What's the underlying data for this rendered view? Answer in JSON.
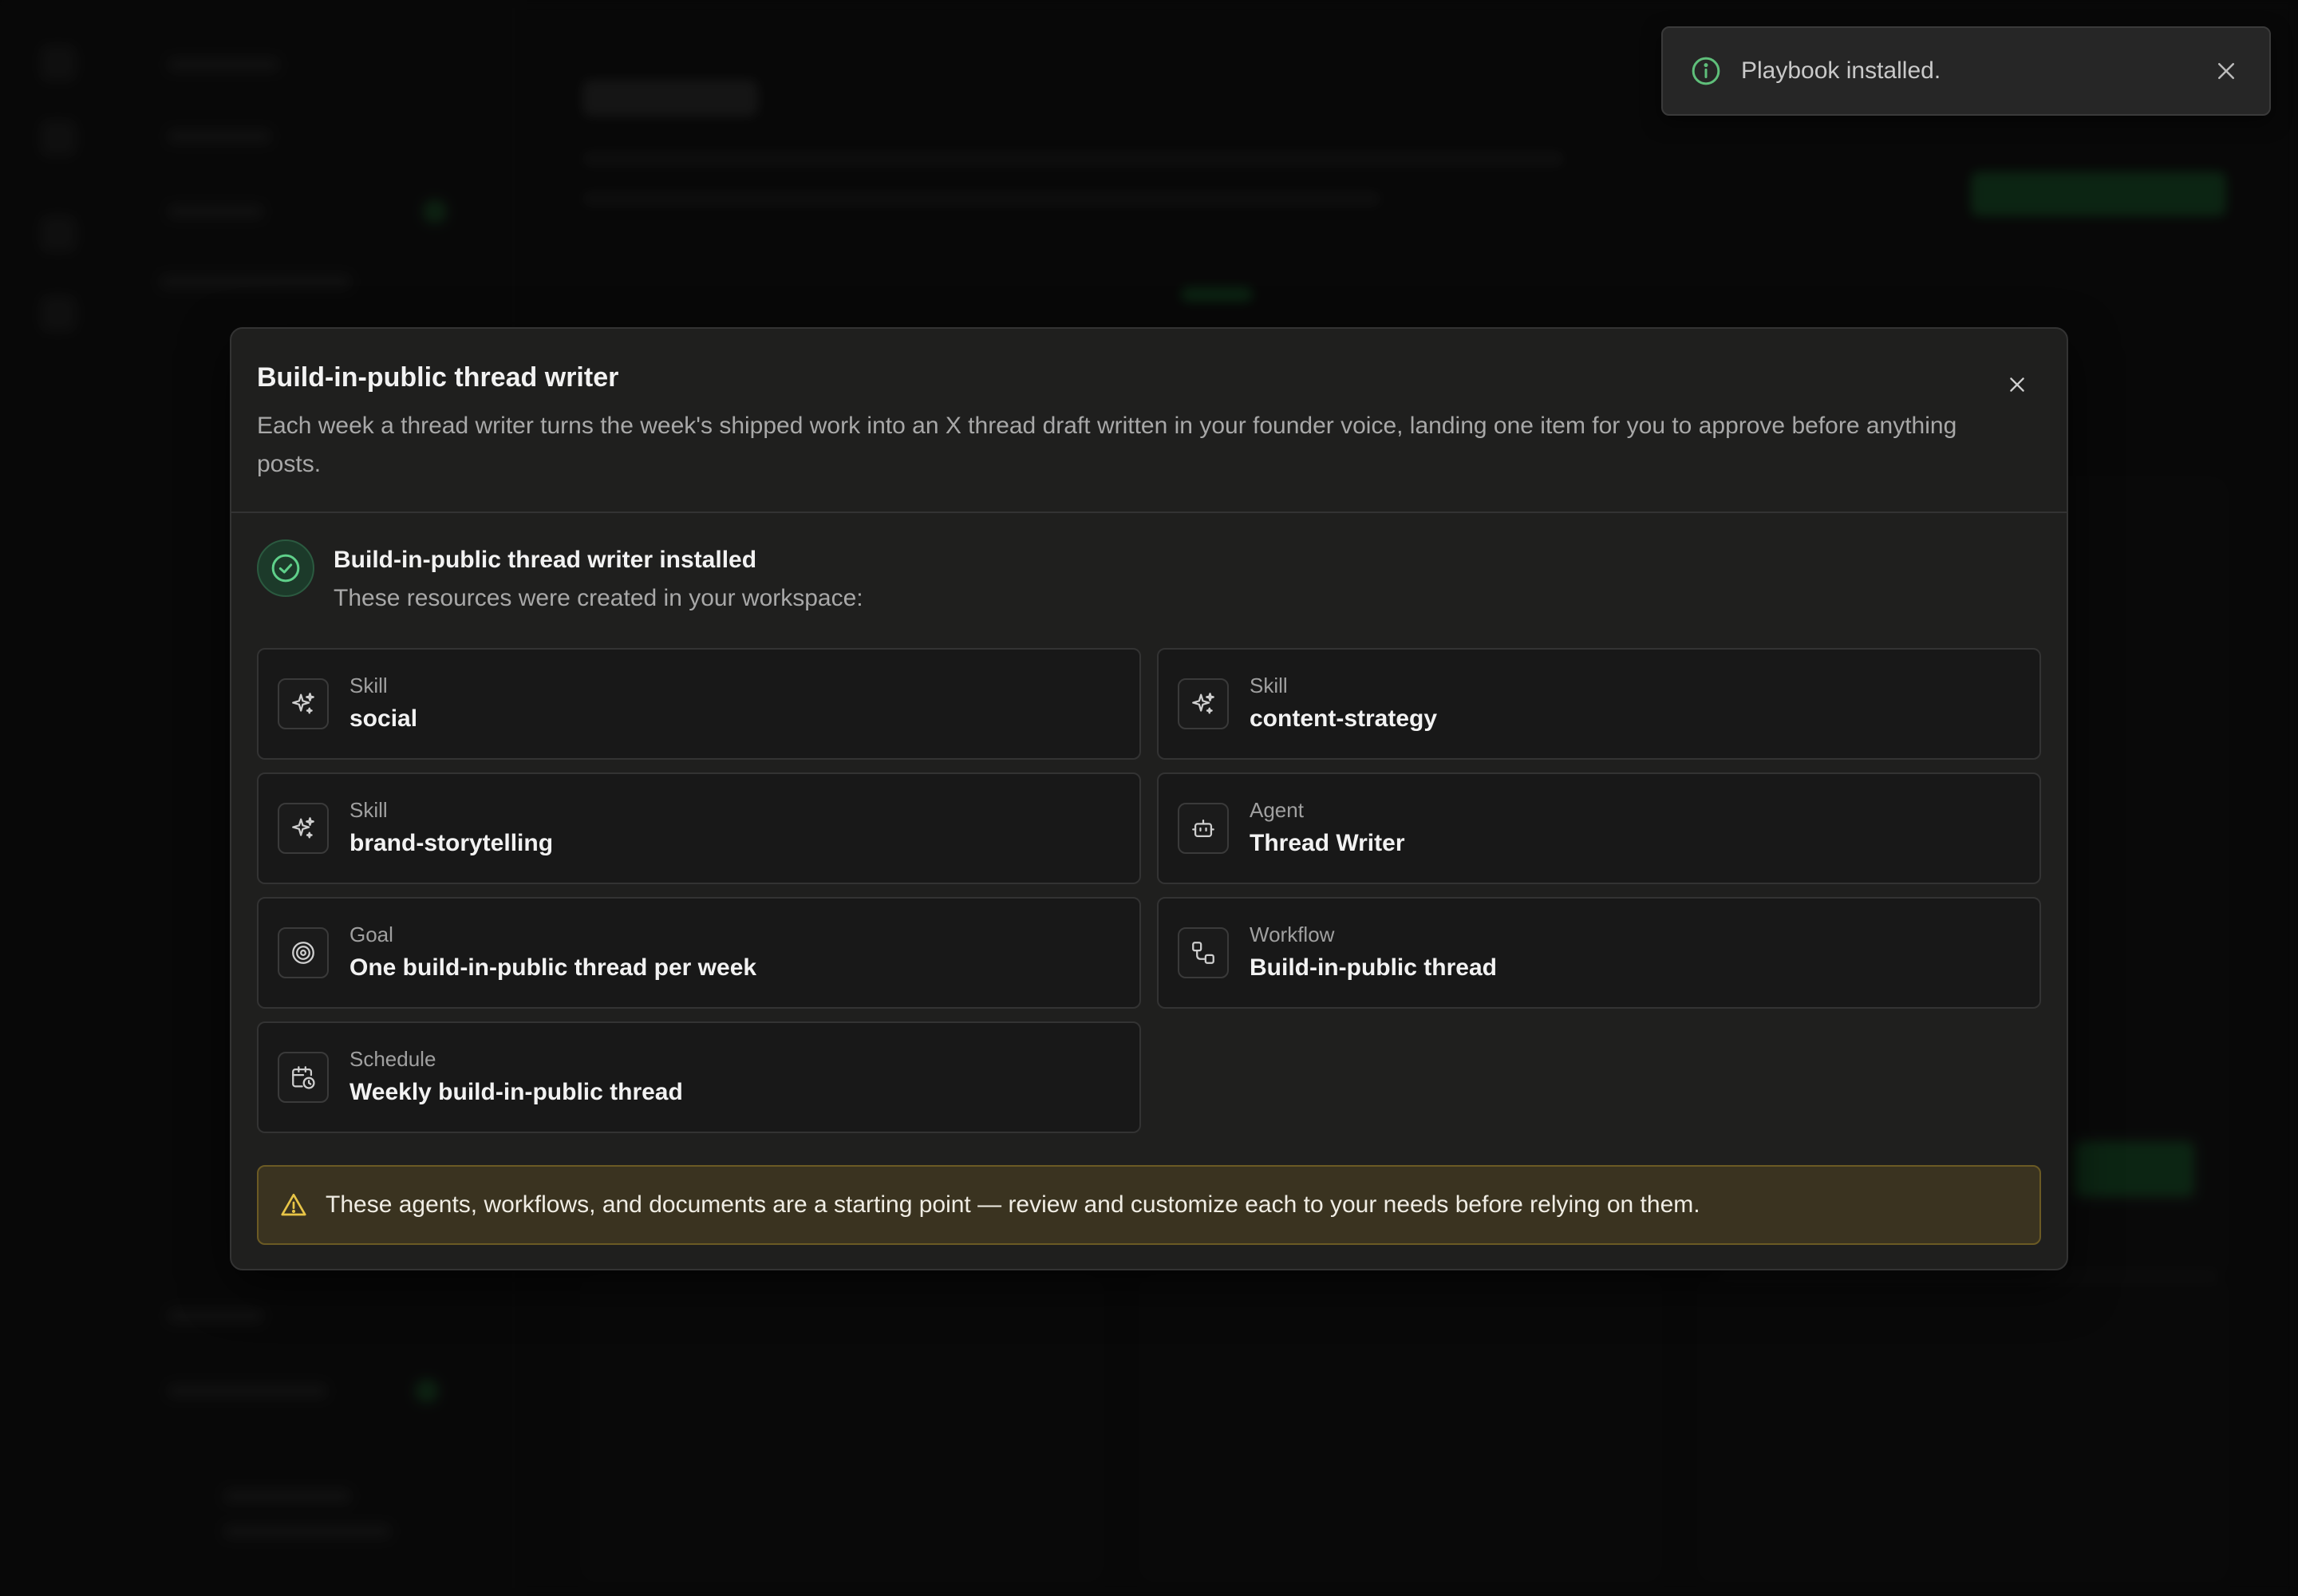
{
  "toast": {
    "message": "Playbook installed.",
    "icon": "info-icon",
    "accent": "#5fbf7a"
  },
  "modal": {
    "title": "Build-in-public thread writer",
    "description": "Each week a thread writer turns the week's shipped work into an X thread draft written in your founder voice, landing one item for you to approve before anything posts.",
    "installed_title": "Build-in-public thread writer installed",
    "installed_subtitle": "These resources were created in your workspace:",
    "resources": [
      {
        "kind": "Skill",
        "name": "social",
        "icon": "sparkles-icon"
      },
      {
        "kind": "Skill",
        "name": "content-strategy",
        "icon": "sparkles-icon"
      },
      {
        "kind": "Skill",
        "name": "brand-storytelling",
        "icon": "sparkles-icon"
      },
      {
        "kind": "Agent",
        "name": "Thread Writer",
        "icon": "bot-icon"
      },
      {
        "kind": "Goal",
        "name": "One build-in-public thread per week",
        "icon": "target-icon"
      },
      {
        "kind": "Workflow",
        "name": "Build-in-public thread",
        "icon": "workflow-icon"
      },
      {
        "kind": "Schedule",
        "name": "Weekly build-in-public thread",
        "icon": "calendar-clock-icon"
      }
    ],
    "warning": "These agents, workflows, and documents are a starting point — review and customize each to your needs before relying on them.",
    "colors": {
      "success": "#5fd08a",
      "warning_border": "#6b5a24",
      "warning_icon": "#e8c547"
    }
  }
}
